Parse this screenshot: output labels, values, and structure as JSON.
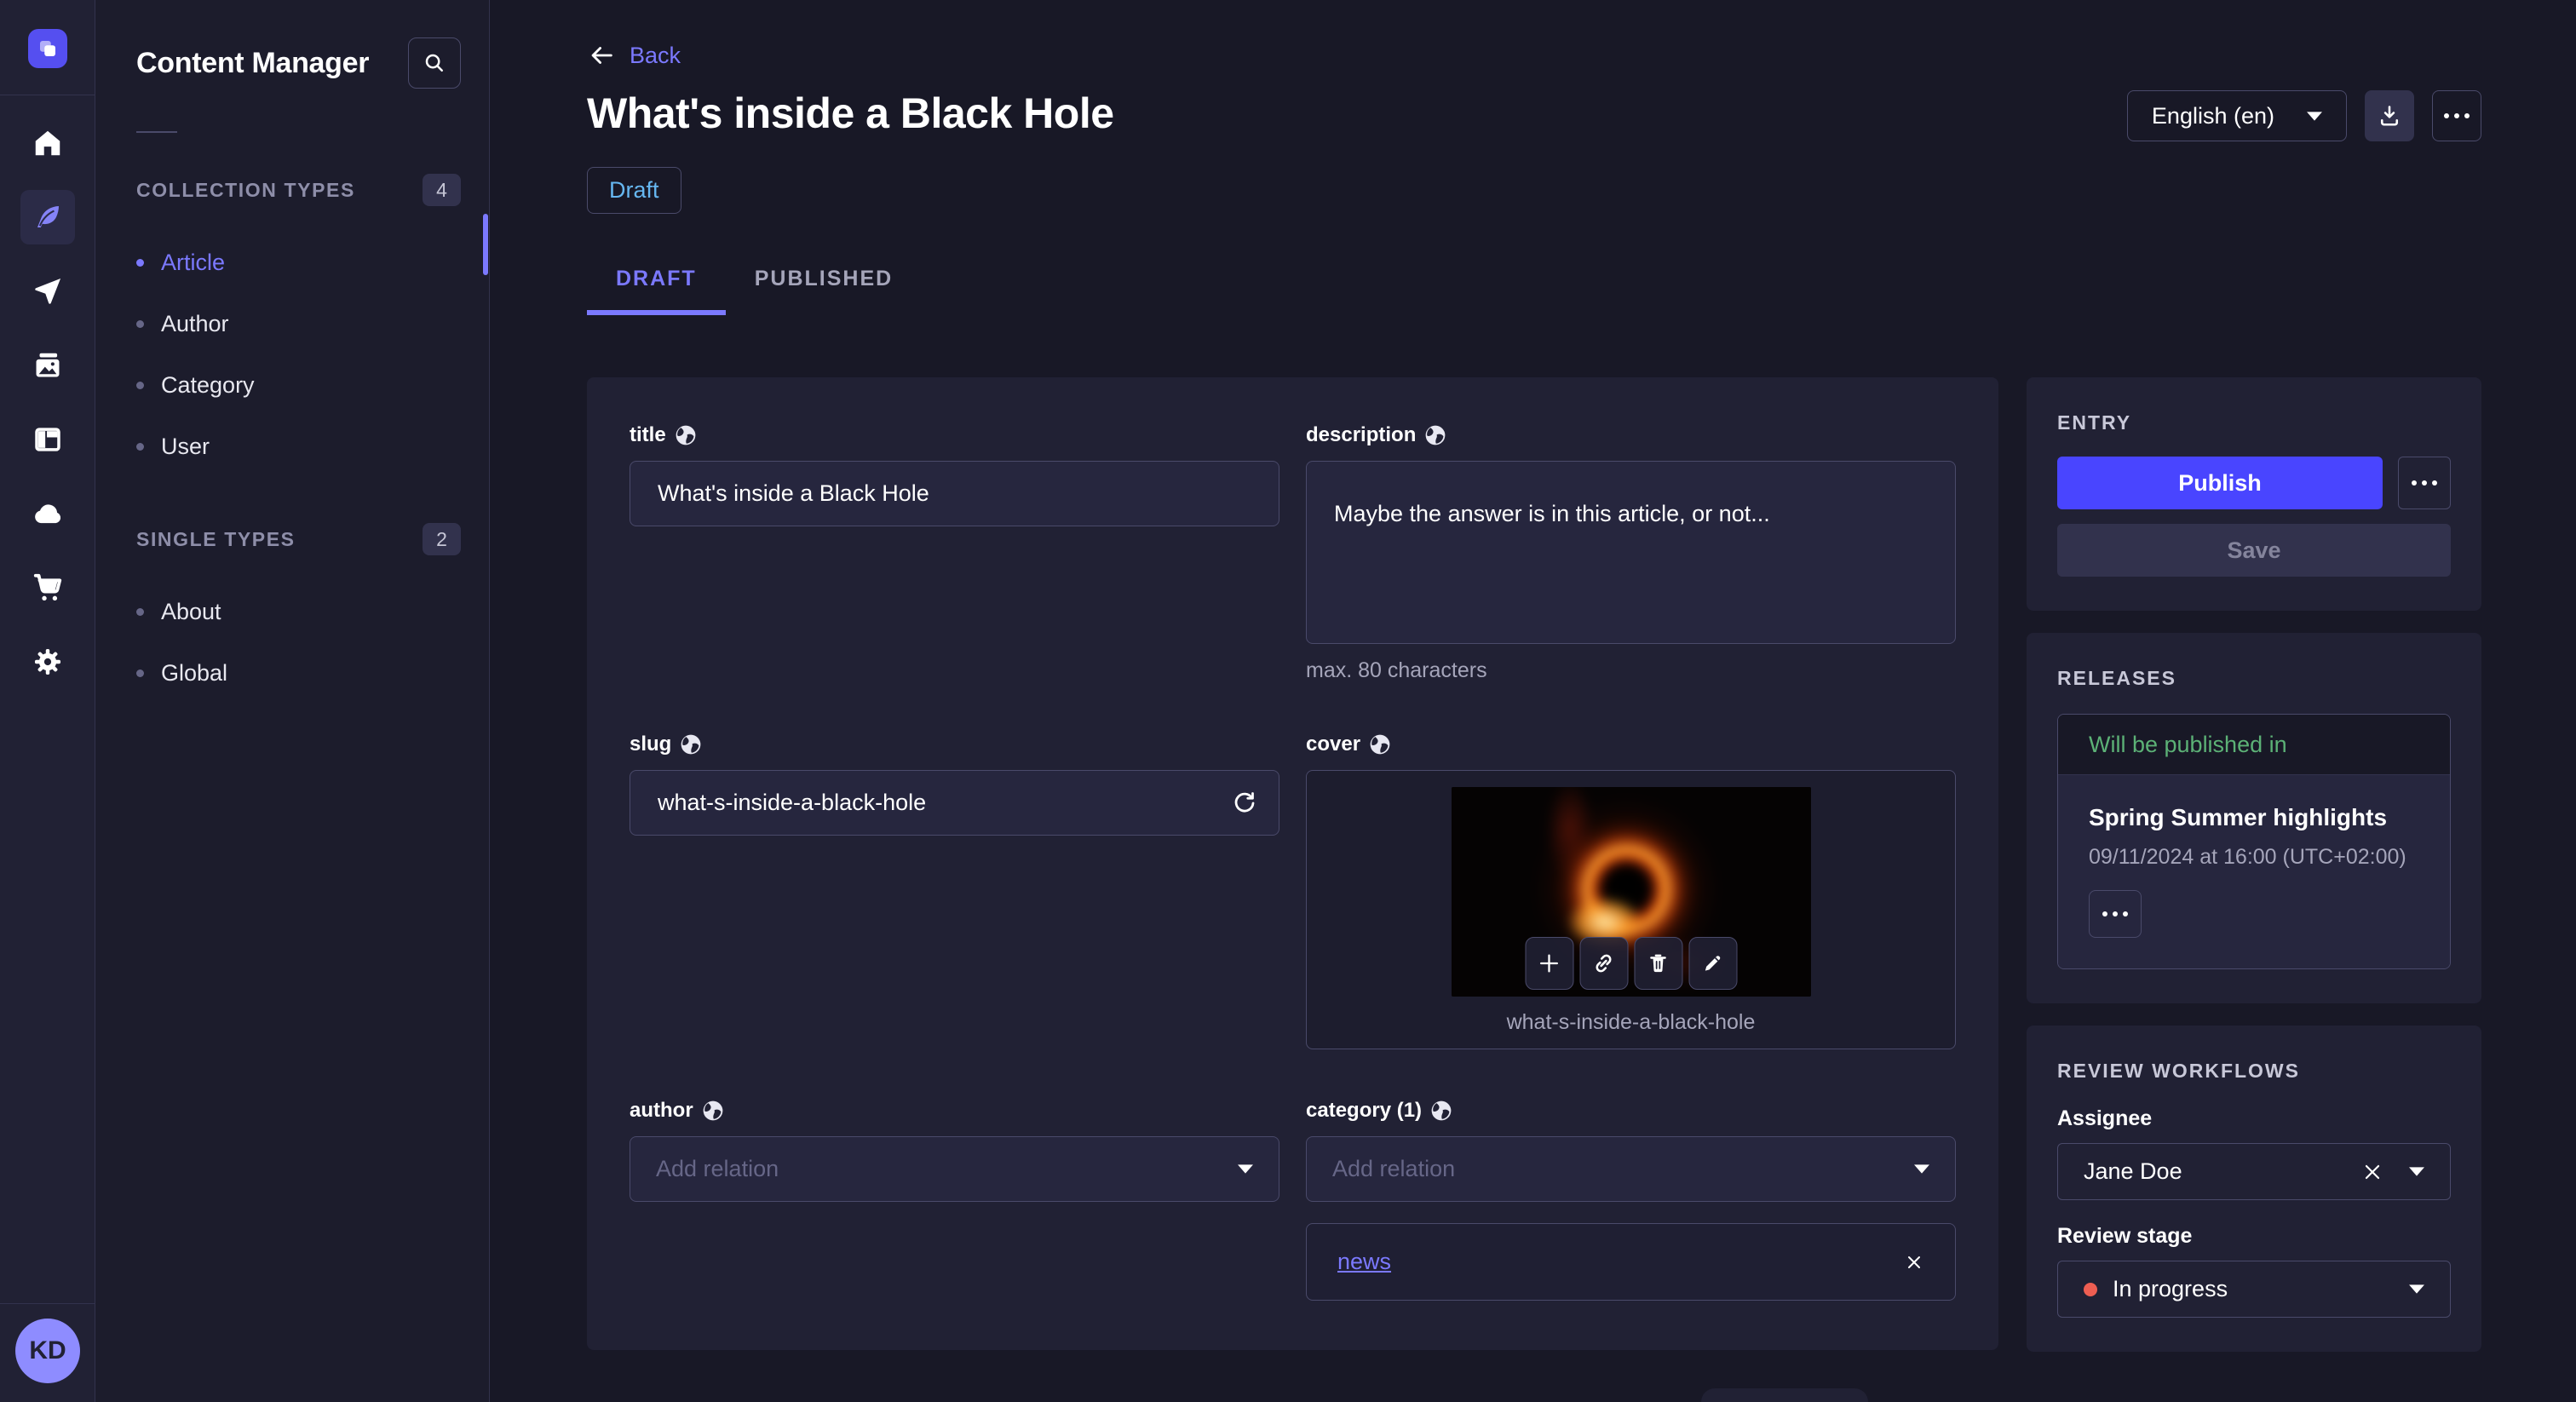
{
  "rail": {
    "avatar_initials": "KD",
    "icons": [
      "strapi-logo",
      "home-icon",
      "feather-icon",
      "paper-plane-icon",
      "media-library-icon",
      "content-type-builder-icon",
      "cloud-icon",
      "marketplace-cart-icon",
      "settings-gear-icon"
    ]
  },
  "sidebar": {
    "title": "Content Manager",
    "sections": [
      {
        "label": "COLLECTION TYPES",
        "count": "4",
        "items": [
          {
            "label": "Article"
          },
          {
            "label": "Author"
          },
          {
            "label": "Category"
          },
          {
            "label": "User"
          }
        ]
      },
      {
        "label": "SINGLE TYPES",
        "count": "2",
        "items": [
          {
            "label": "About"
          },
          {
            "label": "Global"
          }
        ]
      }
    ]
  },
  "header": {
    "back_label": "Back",
    "title": "What's inside a Black Hole",
    "status": "Draft",
    "language": "English (en)"
  },
  "tabs": {
    "draft": "DRAFT",
    "published": "PUBLISHED"
  },
  "form": {
    "title": {
      "label": "title",
      "value": "What's inside a Black Hole"
    },
    "description": {
      "label": "description",
      "value": "Maybe the answer is in this article, or not...",
      "helper": "max. 80 characters"
    },
    "slug": {
      "label": "slug",
      "value": "what-s-inside-a-black-hole"
    },
    "cover": {
      "label": "cover",
      "caption": "what-s-inside-a-black-hole"
    },
    "author": {
      "label": "author",
      "placeholder": "Add relation"
    },
    "category": {
      "label": "category (1)",
      "placeholder": "Add relation",
      "selected_relation": "news"
    }
  },
  "entry_panel": {
    "header": "ENTRY",
    "publish_label": "Publish",
    "save_label": "Save"
  },
  "releases_panel": {
    "header": "RELEASES",
    "status": "Will be published in",
    "release_title": "Spring Summer highlights",
    "release_date": "09/11/2024 at 16:00 (UTC+02:00)"
  },
  "review_panel": {
    "header": "REVIEW WORKFLOWS",
    "assignee_label": "Assignee",
    "assignee_value": "Jane Doe",
    "stage_label": "Review stage",
    "stage_value": "In progress"
  },
  "colors": {
    "primary": "#4945ff",
    "primary_light": "#7b79ff",
    "draft_blue": "#66b7f1",
    "success_green": "#5cb176",
    "stage_red": "#ee5e52",
    "app_bg": "#181826",
    "panel_bg": "#212134",
    "border": "#4a4a6a"
  }
}
